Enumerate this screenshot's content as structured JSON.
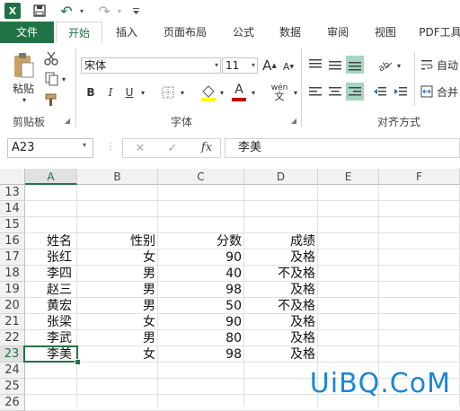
{
  "qat": {
    "logo": "X",
    "dropdown_glyph": "▾"
  },
  "tabs": [
    "文件",
    "开始",
    "插入",
    "页面布局",
    "公式",
    "数据",
    "审阅",
    "视图",
    "PDF工具"
  ],
  "ribbon": {
    "clipboard": {
      "paste_label": "粘贴",
      "group_label": "剪贴板"
    },
    "font": {
      "font_name": "宋体",
      "font_size": "11",
      "bold": "B",
      "italic": "I",
      "underline": "U",
      "grow": "A",
      "shrink": "A",
      "font_color_letter": "A",
      "phonetic": "wén",
      "group_label": "字体"
    },
    "alignment": {
      "wrap_label": "自动",
      "merge_label": "合并",
      "group_label": "对齐方式"
    },
    "colors": {
      "accent": "#217346",
      "highlight": "#ffff00",
      "font_color": "#c00000"
    }
  },
  "formula_bar": {
    "name_box": "A23",
    "cancel": "✕",
    "enter": "✓",
    "fx": "fx",
    "content": "李美"
  },
  "sheet": {
    "columns": [
      "A",
      "B",
      "C",
      "D",
      "E",
      "F"
    ],
    "rows": [
      "13",
      "14",
      "15",
      "16",
      "17",
      "18",
      "19",
      "20",
      "21",
      "22",
      "23",
      "24",
      "25",
      "26"
    ],
    "header_row": [
      "姓名",
      "性别",
      "分数",
      "成绩"
    ],
    "data": [
      [
        "张红",
        "女",
        "90",
        "及格"
      ],
      [
        "李四",
        "男",
        "40",
        "不及格"
      ],
      [
        "赵三",
        "男",
        "98",
        "及格"
      ],
      [
        "黄宏",
        "男",
        "50",
        "不及格"
      ],
      [
        "张梁",
        "女",
        "90",
        "及格"
      ],
      [
        "李武",
        "男",
        "80",
        "及格"
      ],
      [
        "李美",
        "女",
        "98",
        "及格"
      ]
    ],
    "active_cell": "A23"
  },
  "watermark": "UiBQ.CoM"
}
